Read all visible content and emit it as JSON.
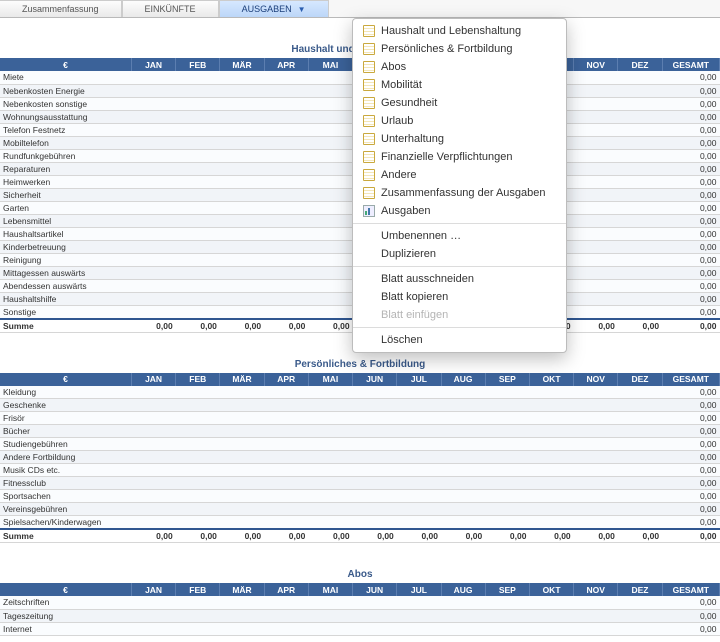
{
  "tabs": {
    "summary": "Zusammenfassung",
    "income": "EINKÜNFTE",
    "expenses": "AUSGABEN"
  },
  "months": [
    "JAN",
    "FEB",
    "MÄR",
    "APR",
    "MAI",
    "JUN",
    "JUL",
    "AUG",
    "SEP",
    "OKT",
    "NOV",
    "DEZ"
  ],
  "currency_header": "€",
  "total_header": "GESAMT",
  "sum_label": "Summe",
  "zero_short": "0,00",
  "sections": {
    "household": {
      "title": "Haushalt und Lebenshaltung",
      "rows": [
        "Miete",
        "Nebenkosten Energie",
        "Nebenkosten sonstige",
        "Wohnungsausstattung",
        "Telefon Festnetz",
        "Mobiltelefon",
        "Rundfunkgebühren",
        "Reparaturen",
        "Heimwerken",
        "Sicherheit",
        "Garten",
        "Lebensmittel",
        "Haushaltsartikel",
        "Kinderbetreuung",
        "Reinigung",
        "Mittagessen auswärts",
        "Abendessen auswärts",
        "Haushaltshilfe",
        "Sonstige"
      ]
    },
    "personal": {
      "title": "Persönliches & Fortbildung",
      "rows": [
        "Kleidung",
        "Geschenke",
        "Frisör",
        "Bücher",
        "Studiengebühren",
        "Andere Fortbildung",
        "Musik CDs etc.",
        "Fitnessclub",
        "Sportsachen",
        "Vereinsgebühren",
        "Spielsachen/Kinderwagen"
      ]
    },
    "abos": {
      "title": "Abos",
      "rows": [
        "Zeitschriften",
        "Tageszeitung",
        "Internet"
      ]
    }
  },
  "menu": {
    "sheets": [
      "Haushalt und Lebenshaltung",
      "Persönliches & Fortbildung",
      "Abos",
      "Mobilität",
      "Gesundheit",
      "Urlaub",
      "Unterhaltung",
      "Finanzielle Verpflichtungen",
      "Andere",
      "Zusammenfassung der Ausgaben"
    ],
    "chart_sheet": "Ausgaben",
    "rename": "Umbenennen …",
    "duplicate": "Duplizieren",
    "cut": "Blatt ausschneiden",
    "copy": "Blatt kopieren",
    "paste": "Blatt einfügen",
    "delete": "Löschen"
  }
}
